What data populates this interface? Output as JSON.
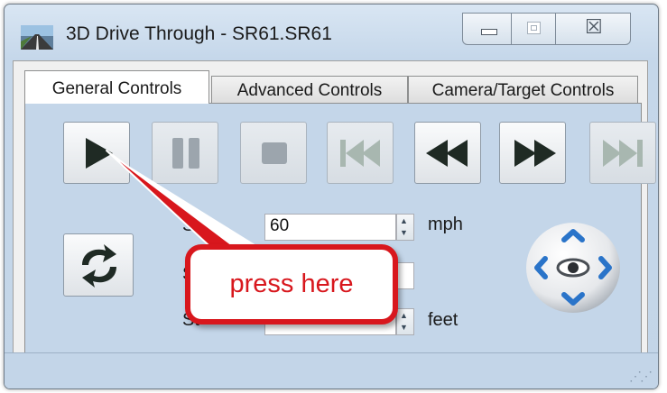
{
  "window": {
    "title": "3D Drive Through - SR61.SR61",
    "caption_buttons": [
      "minimize-icon",
      "maximize-icon",
      "close-icon"
    ],
    "close_glyph": "☒"
  },
  "tabs": [
    {
      "label": "General Controls",
      "selected": true
    },
    {
      "label": "Advanced Controls",
      "selected": false
    },
    {
      "label": "Camera/Target Controls",
      "selected": false
    }
  ],
  "playback_buttons": [
    {
      "name": "play",
      "icon": "play-icon",
      "enabled": true
    },
    {
      "name": "pause",
      "icon": "pause-icon",
      "enabled": false
    },
    {
      "name": "stop",
      "icon": "stop-icon",
      "enabled": false
    },
    {
      "name": "go-to-start",
      "icon": "skip-start-icon",
      "enabled": false
    },
    {
      "name": "rewind",
      "icon": "rewind-icon",
      "enabled": true
    },
    {
      "name": "fast-forward",
      "icon": "fast-forward-icon",
      "enabled": true
    },
    {
      "name": "go-to-end",
      "icon": "skip-end-icon",
      "enabled": false
    }
  ],
  "fields": {
    "speed": {
      "label": "Spe",
      "value": "60",
      "unit": "mph"
    },
    "start": {
      "label": "St",
      "value": ""
    },
    "step": {
      "label": "St",
      "value": "",
      "unit": "feet"
    }
  },
  "refresh_icon": "refresh-icon",
  "nav_pad_icon": "eye-icon",
  "annotation": {
    "text": "press here",
    "color": "#d8171d"
  },
  "colors": {
    "panel": "#c4d6e9",
    "accent_red": "#d8171d"
  }
}
